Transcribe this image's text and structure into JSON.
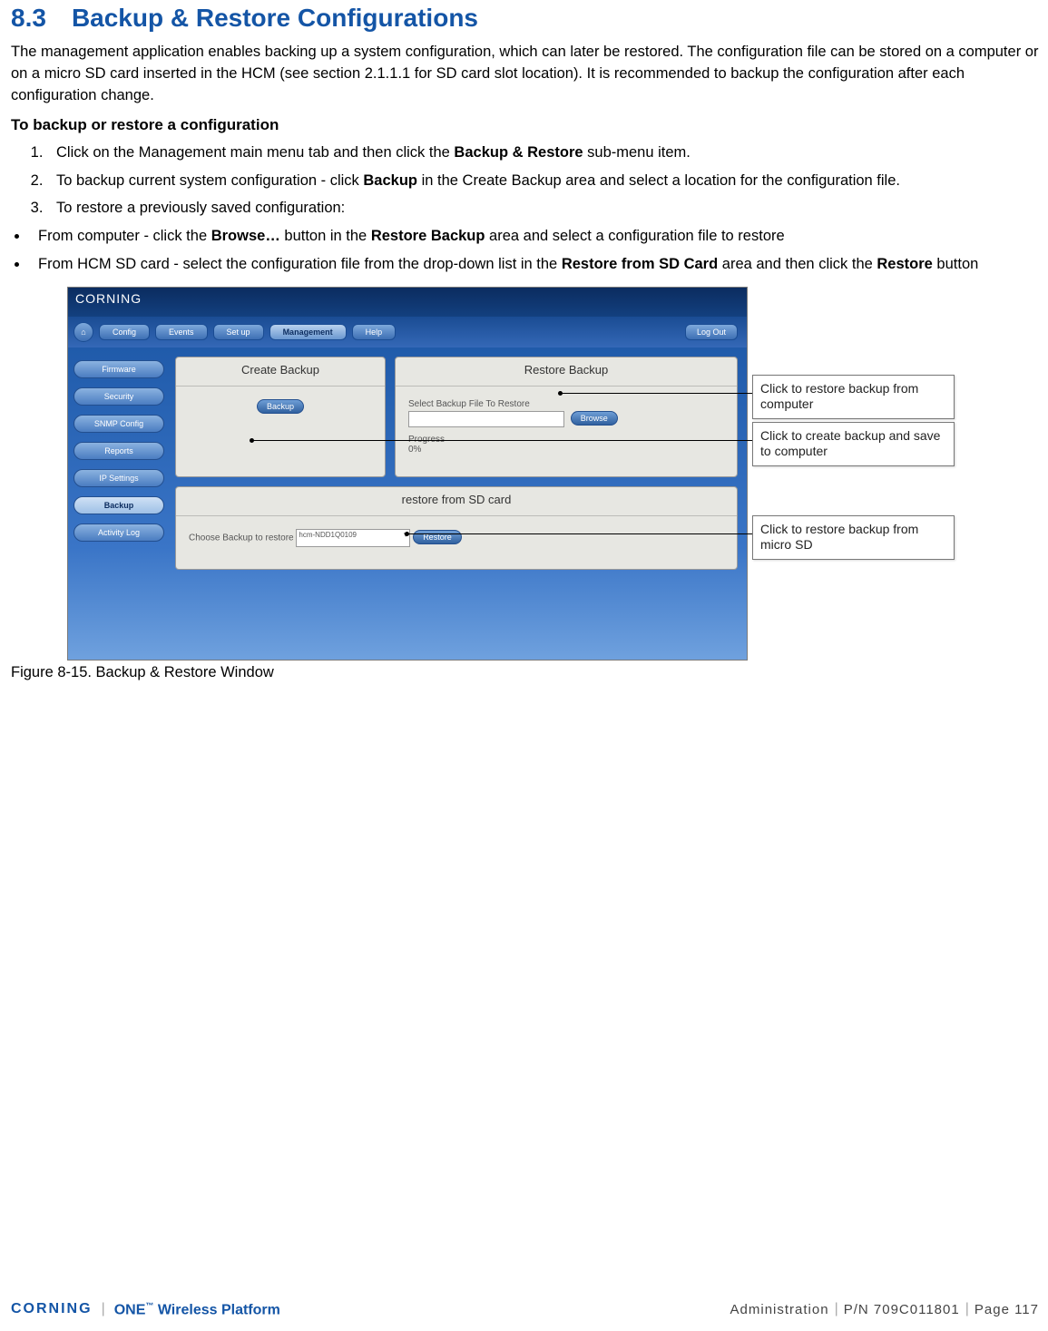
{
  "heading": {
    "number": "8.3",
    "title": "Backup & Restore Configurations"
  },
  "intro": "The management application enables backing up a system configuration, which can later be restored. The configuration file can be stored on a computer or on a micro SD card inserted in the HCM (see section 2.1.1.1 for SD card slot location). It is recommended to backup the configuration after each configuration change.",
  "procedure_title": "To backup or restore a configuration",
  "steps": {
    "s1a": "Click on the Management main menu tab and then click the ",
    "s1b": "Backup & Restore",
    "s1c": " sub-menu item.",
    "s2a": "To backup current system configuration - click ",
    "s2b": "Backup",
    "s2c": " in the Create Backup area and select a location for the configuration file.",
    "s3": "To restore a previously saved configuration:"
  },
  "bullets": {
    "b1a": "From computer - click the ",
    "b1b": "Browse… ",
    "b1c": "button in the ",
    "b1d": "Restore Backup",
    "b1e": " area and select a configuration file to restore",
    "b2a": "From HCM SD card - select the configuration file from the drop-down list in the ",
    "b2b": "Restore from SD Card",
    "b2c": " area and then click the ",
    "b2d": "Restore",
    "b2e": " button"
  },
  "ui": {
    "brand": "CORNING",
    "tabs": [
      "Config",
      "Events",
      "Set up",
      "Management",
      "Help"
    ],
    "logout": "Log Out",
    "sidebar": [
      "Firmware",
      "Security",
      "SNMP Config",
      "Reports",
      "IP Settings",
      "Backup",
      "Activity Log"
    ],
    "create_panel": {
      "title": "Create Backup",
      "button": "Backup"
    },
    "restore_panel": {
      "title": "Restore Backup",
      "select_label": "Select Backup File To Restore",
      "browse": "Browse",
      "progress_label": "Progress",
      "progress_value": "0%"
    },
    "sd_panel": {
      "title": "restore from SD card",
      "choose_label": "Choose Backup to restore",
      "selected": "hcm-NDD1Q0109",
      "button": "Restore"
    }
  },
  "callouts": {
    "c1": "Click to restore backup from computer",
    "c2": "Click to create backup and save to computer",
    "c3": "Click to restore backup from micro SD"
  },
  "caption": "Figure 8-15. Backup & Restore Window",
  "footer": {
    "brand": "CORNING",
    "platform_a": "ONE",
    "platform_b": " Wireless Platform",
    "section": "Administration",
    "pn": "P/N 709C011801",
    "page": "Page 117"
  }
}
